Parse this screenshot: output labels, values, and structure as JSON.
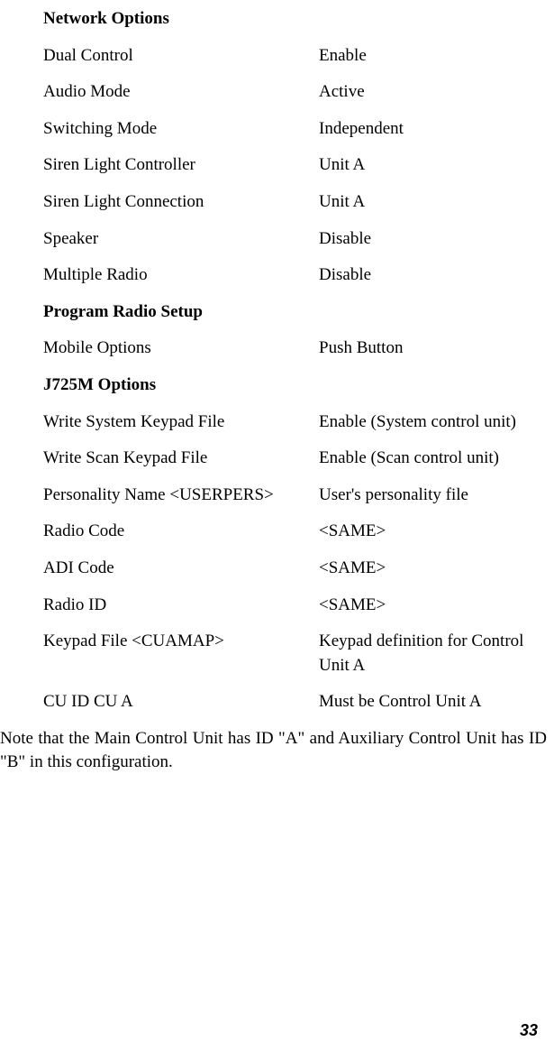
{
  "sections": {
    "network_options": {
      "heading": "Network Options",
      "rows": [
        {
          "label": "Dual Control",
          "value": "Enable"
        },
        {
          "label": "Audio Mode",
          "value": "Active"
        },
        {
          "label": "Switching Mode",
          "value": "Independent"
        },
        {
          "label": "Siren Light Controller",
          "value": "Unit A"
        },
        {
          "label": "Siren Light Connection",
          "value": "Unit A"
        },
        {
          "label": "Speaker",
          "value": "Disable"
        },
        {
          "label": "Multiple Radio",
          "value": "Disable"
        }
      ]
    },
    "program_radio_setup": {
      "heading": "Program Radio Setup",
      "rows": [
        {
          "label": "Mobile Options",
          "value": "Push Button"
        }
      ]
    },
    "j725m_options": {
      "heading": "J725M Options",
      "rows": [
        {
          "label": "Write System Keypad File",
          "value": "Enable (System control unit)"
        },
        {
          "label": "Write Scan Keypad File",
          "value": "Enable (Scan control unit)"
        },
        {
          "label": "Personality Name  <USERPERS>",
          "value": "User's personality file"
        },
        {
          "label": "Radio Code",
          "value": "<SAME>"
        },
        {
          "label": "ADI Code",
          "value": "<SAME>"
        },
        {
          "label": "Radio ID",
          "value": "<SAME>"
        },
        {
          "label": "Keypad File <CUAMAP>",
          "value": "Keypad definition for Control Unit A"
        },
        {
          "label": "CU ID  CU A",
          "value": "Must be Control Unit A"
        }
      ]
    }
  },
  "note": "Note that the Main Control Unit has ID \"A\" and Auxiliary Control Unit has ID \"B\" in this configuration.",
  "page_number": "33"
}
